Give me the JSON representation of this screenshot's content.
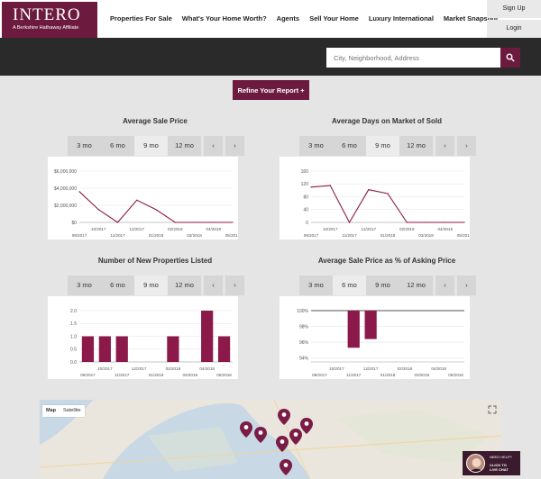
{
  "header": {
    "logo_main": "INTERO",
    "logo_sub": "A Berkshire Hathaway Affiliate",
    "nav": [
      "Properties For Sale",
      "What's Your Home Worth?",
      "Agents",
      "Sell Your Home",
      "Luxury International",
      "Market Snapshot"
    ],
    "sign_up": "Sign Up",
    "login": "Login"
  },
  "search": {
    "placeholder": "City, Neighborhood, Address"
  },
  "refine_label": "Refine Your Report +",
  "period_buttons": [
    "3 mo",
    "6 mo",
    "9 mo",
    "12 mo"
  ],
  "period_active": "9 mo",
  "prev_label": "‹",
  "next_label": "›",
  "chart_data": [
    {
      "type": "line",
      "title": "Average Sale Price",
      "x": [
        "09/2017",
        "10/2017",
        "11/2017",
        "12/2017",
        "01/2018",
        "02/2018",
        "03/2018",
        "04/2018",
        "05/2018"
      ],
      "x_tick_labels": [
        "09/2017",
        "10/2017",
        "11/2017",
        "12/2017",
        "01/2018",
        "02/2018",
        "03/2018",
        "04/2018",
        "05/2018"
      ],
      "values": [
        3600000,
        1500000,
        0,
        2600000,
        1500000,
        0,
        0,
        0,
        0
      ],
      "y_ticks": [
        "$6,000,000",
        "$4,000,000",
        "$2,000,000",
        "$0"
      ],
      "y_tick_values": [
        6000000,
        4000000,
        2000000,
        0
      ],
      "ylim": [
        0,
        6000000
      ],
      "color": "#8b1a4a"
    },
    {
      "type": "line",
      "title": "Average Days on Market of Sold",
      "x": [
        "09/2017",
        "10/2017",
        "11/2017",
        "12/2017",
        "01/2018",
        "02/2018",
        "03/2018",
        "04/2018",
        "05/2018"
      ],
      "x_tick_labels": [
        "09/2017",
        "10/2017",
        "11/2017",
        "12/2017",
        "01/2018",
        "02/2018",
        "03/2018",
        "04/2018",
        "05/2018"
      ],
      "values": [
        110,
        115,
        0,
        102,
        90,
        0,
        0,
        0,
        0
      ],
      "y_ticks": [
        "160",
        "120",
        "80",
        "40",
        "0"
      ],
      "y_tick_values": [
        160,
        120,
        80,
        40,
        0
      ],
      "ylim": [
        0,
        160
      ],
      "color": "#8b1a4a"
    },
    {
      "type": "bar",
      "title": "Number of New Properties Listed",
      "categories": [
        "09/2017",
        "10/2017",
        "11/2017",
        "12/2017",
        "01/2018",
        "02/2018",
        "03/2018",
        "04/2018",
        "05/2018"
      ],
      "x_tick_labels": [
        "09/2017",
        "10/2017",
        "11/2017",
        "12/2017",
        "01/2018",
        "02/2018",
        "03/2018",
        "04/2018",
        "05/2018"
      ],
      "values": [
        1,
        1,
        1,
        0,
        0,
        1,
        0,
        2,
        1
      ],
      "y_ticks": [
        "2.0",
        "1.5",
        "1.0",
        "0.5",
        "0.0"
      ],
      "y_tick_values": [
        2.0,
        1.5,
        1.0,
        0.5,
        0.0
      ],
      "ylim": [
        0,
        2
      ],
      "color": "#8b1a4a"
    },
    {
      "type": "bar",
      "title": "Average Sale Price as % of Asking Price",
      "categories": [
        "09/2017",
        "10/2017",
        "11/2017",
        "12/2017",
        "01/2018",
        "02/2018",
        "03/2018",
        "04/2018",
        "05/2018"
      ],
      "x_tick_labels": [
        "09/2017",
        "10/2017",
        "11/2017",
        "12/2017",
        "01/2018",
        "02/2018",
        "03/2018",
        "04/2018",
        "05/2018"
      ],
      "values": [
        100,
        100,
        95.3,
        96.4,
        100,
        100,
        100,
        100,
        100
      ],
      "y_ticks": [
        "100%",
        "98%",
        "96%",
        "94%"
      ],
      "y_tick_values": [
        100,
        98,
        96,
        94
      ],
      "ylim": [
        93.5,
        100
      ],
      "baseline": 100,
      "color": "#8b1a4a"
    }
  ],
  "map": {
    "type_options": [
      "Map",
      "Satellite"
    ],
    "type_active": "Map",
    "water_color": "#c8d9e5",
    "land_color": "#ebe6dd",
    "pin_color": "#7a1c45",
    "pin_count": 7
  },
  "chat": {
    "help": "NEED HELP?",
    "cta_line1": "CLICK TO",
    "cta_line2": "LIVE CHAT"
  },
  "colors": {
    "brand": "#6d1a3f",
    "band": "#2a2a2a",
    "page_bg": "#e5e5e5"
  }
}
